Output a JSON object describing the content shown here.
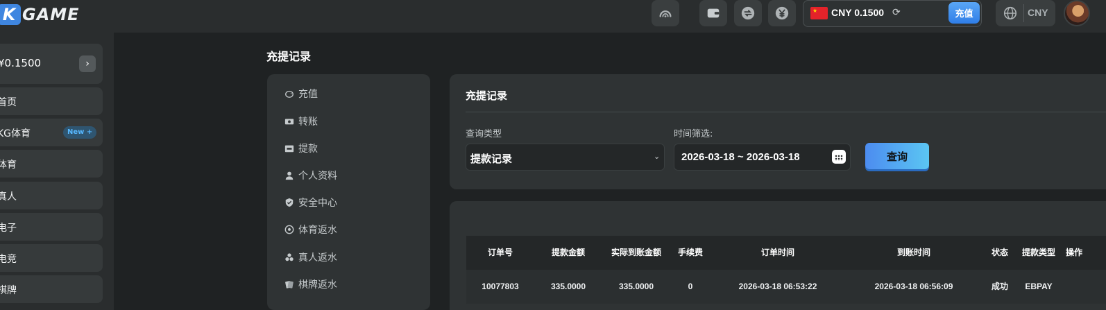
{
  "header": {
    "logo_badge": "K",
    "logo_text": "GAME",
    "icons": [
      "speed-icon",
      "wallet-icon",
      "transfer-icon",
      "yuan-icon"
    ],
    "wallet": {
      "currency_amount": "CNY 0.1500",
      "recharge_label": "充值"
    },
    "language": "CNY"
  },
  "sidebar": {
    "balance": "¥0.1500",
    "items": [
      {
        "label": "首页"
      },
      {
        "label": "KG体育",
        "badge": "New +"
      },
      {
        "label": "体育"
      },
      {
        "label": "真人"
      },
      {
        "label": "电子"
      },
      {
        "label": "电竞"
      },
      {
        "label": "棋牌"
      }
    ]
  },
  "page": {
    "title": "充提记录"
  },
  "menu": {
    "items": [
      {
        "label": "充值",
        "icon": "piggy-icon"
      },
      {
        "label": "转账",
        "icon": "money-icon"
      },
      {
        "label": "提款",
        "icon": "atm-icon"
      },
      {
        "label": "个人资料",
        "icon": "user-icon"
      },
      {
        "label": "安全中心",
        "icon": "shield-icon"
      },
      {
        "label": "体育返水",
        "icon": "soccer-icon"
      },
      {
        "label": "真人返水",
        "icon": "chips-icon"
      },
      {
        "label": "棋牌返水",
        "icon": "cards-icon"
      }
    ]
  },
  "filter": {
    "title": "充提记录",
    "type_label": "查询类型",
    "type_value": "提款记录",
    "time_label": "时间筛选:",
    "date_range": "2026-03-18 ~ 2026-03-18",
    "query_label": "查询"
  },
  "table": {
    "columns": [
      "订单号",
      "提款金额",
      "实际到账金额",
      "手续费",
      "订单时间",
      "到账时间",
      "状态",
      "提款类型",
      "操作"
    ],
    "rows": [
      [
        "10077803",
        "335.0000",
        "335.0000",
        "0",
        "2026-03-18 06:53:22",
        "2026-03-18 06:56:09",
        "成功",
        "EBPAY",
        ""
      ]
    ]
  },
  "colors": {
    "accent": "#3f86e0",
    "bg": "#1f2223",
    "panel": "#2f3334"
  }
}
